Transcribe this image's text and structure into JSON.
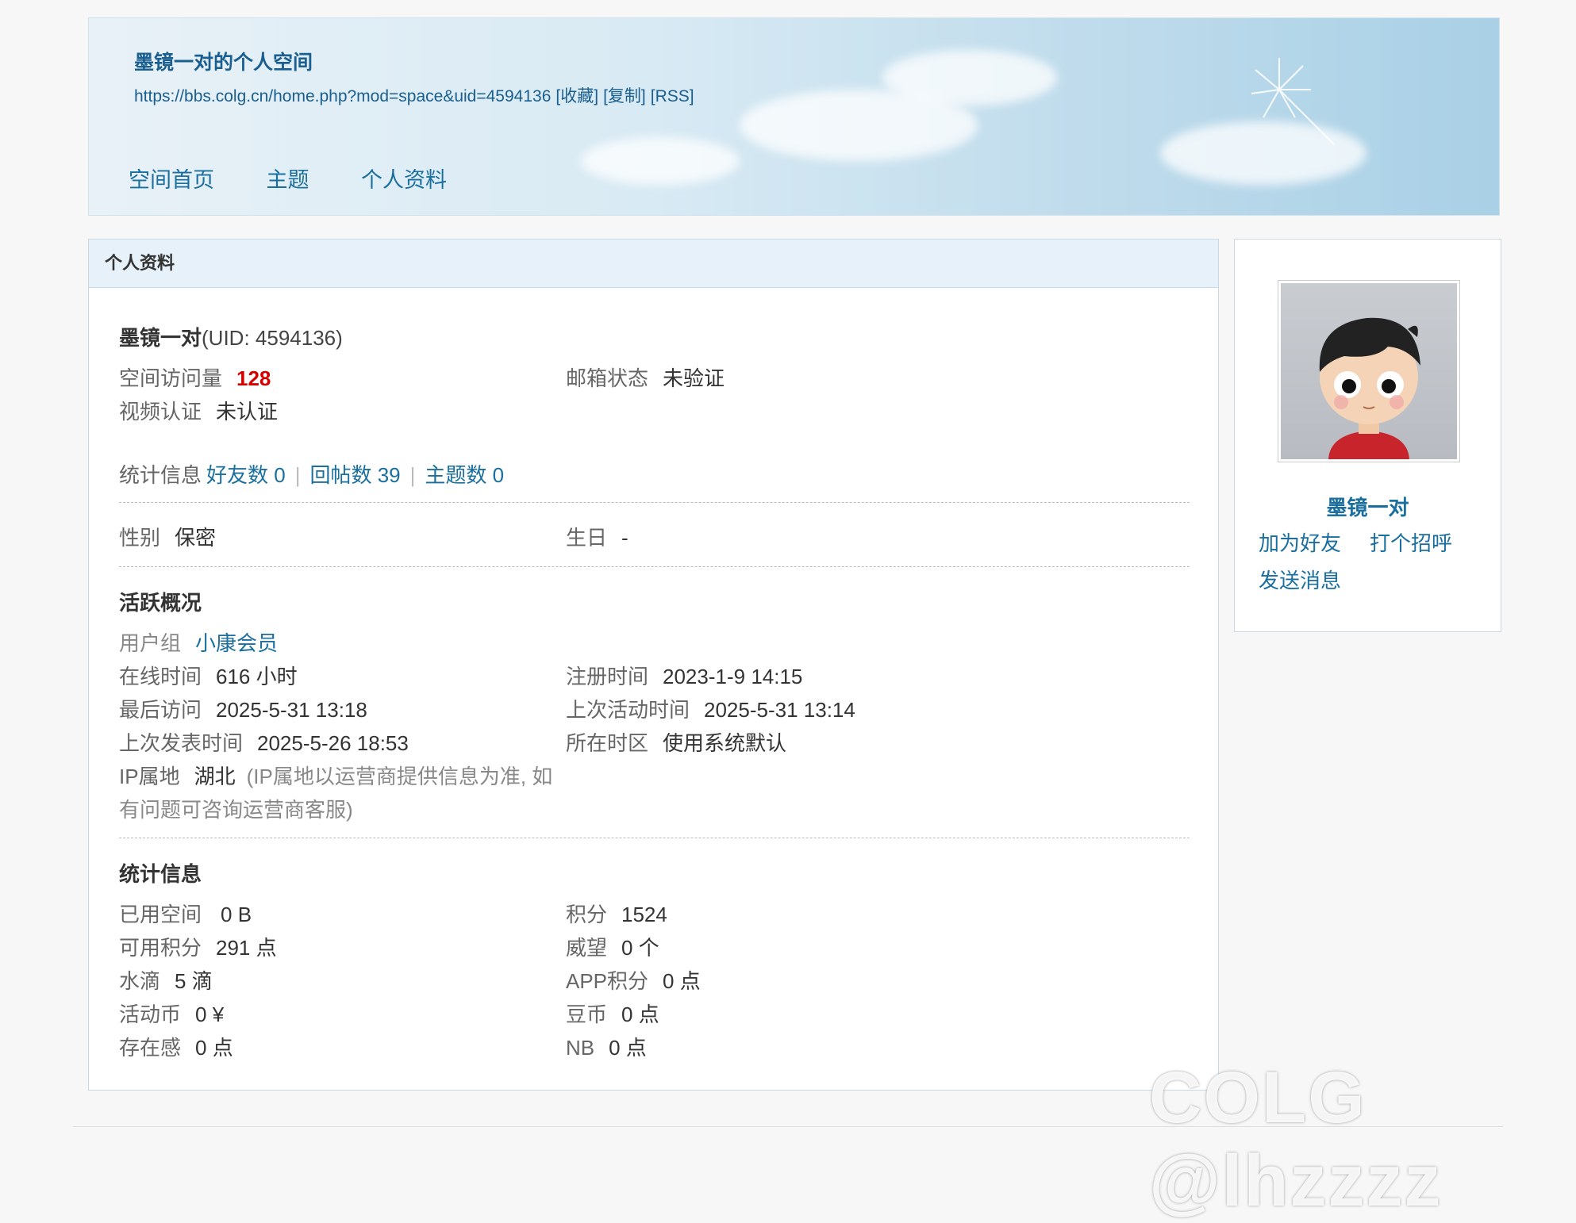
{
  "header": {
    "title": "墨镜一对的个人空间",
    "url": "https://bbs.colg.cn/home.php?mod=space&uid=4594136",
    "url_actions": [
      "[收藏]",
      "[复制]",
      "[RSS]"
    ],
    "nav": [
      "空间首页",
      "主题",
      "个人资料"
    ]
  },
  "panel": {
    "title": "个人资料",
    "user_name": "墨镜一对",
    "uid_text": "(UID: 4594136)",
    "visits_label": "空间访问量",
    "visits_value": "128",
    "email_label": "邮箱状态",
    "email_value": "未验证",
    "video_label": "视频认证",
    "video_value": "未认证",
    "stats_label": "统计信息",
    "friends": "好友数 0",
    "replies": "回帖数 39",
    "topics": "主题数 0",
    "separator": "|",
    "gender_label": "性别",
    "gender_value": "保密",
    "birthday_label": "生日",
    "birthday_value": "-",
    "activity_title": "活跃概况",
    "group_label": "用户组",
    "group_value": "小康会员",
    "online_label": "在线时间",
    "online_value": "616 小时",
    "reg_label": "注册时间",
    "reg_value": "2023-1-9 14:15",
    "last_visit_label": "最后访问",
    "last_visit_value": "2025-5-31 13:18",
    "last_active_label": "上次活动时间",
    "last_active_value": "2025-5-31 13:14",
    "last_post_label": "上次发表时间",
    "last_post_value": "2025-5-26 18:53",
    "tz_label": "所在时区",
    "tz_value": "使用系统默认",
    "ip_label": "IP属地",
    "ip_value": "湖北",
    "ip_note_1": "(IP属地以运营商提供信息为准, 如",
    "ip_note_2": "有问题可咨询运营商客服)",
    "stat_title": "统计信息",
    "used_space_label": "已用空间",
    "used_space_value": "0 B",
    "points_label": "积分",
    "points_value": "1524",
    "avail_label": "可用积分",
    "avail_value": "291 点",
    "prestige_label": "威望",
    "prestige_value": "0 个",
    "water_label": "水滴",
    "water_value": "5 滴",
    "app_label": "APP积分",
    "app_value": "0 点",
    "coin_label": "活动币",
    "coin_value": "0 ¥",
    "bean_label": "豆币",
    "bean_value": "0 点",
    "presence_label": "存在感",
    "presence_value": "0 点",
    "nb_label": "NB",
    "nb_value": "0 点"
  },
  "sidebar": {
    "name": "墨镜一对",
    "add_friend": "加为好友",
    "greet": "打个招呼",
    "message": "发送消息"
  },
  "watermark": "COLG @lhzzzz"
}
